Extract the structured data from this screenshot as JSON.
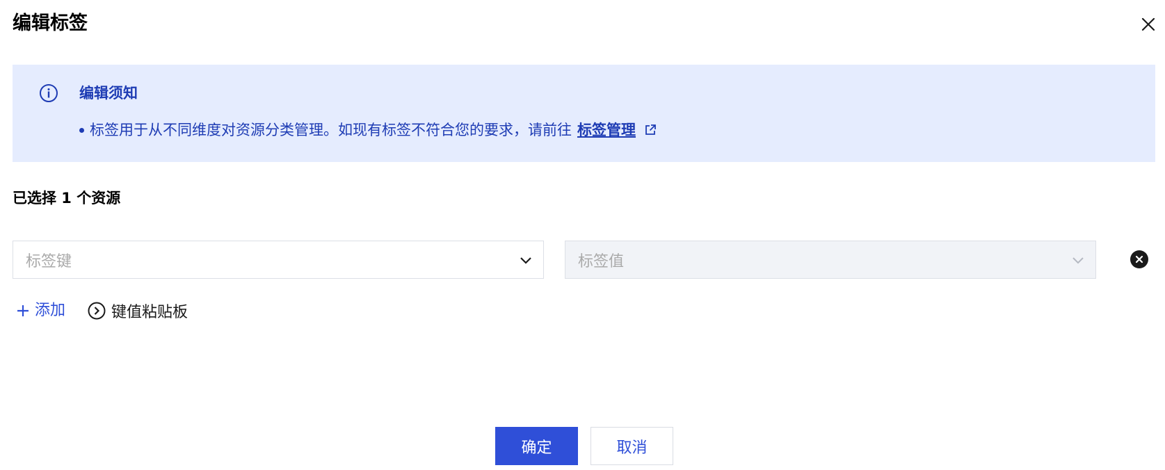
{
  "dialog": {
    "title": "编辑标签"
  },
  "notice": {
    "title": "编辑须知",
    "text": "标签用于从不同维度对资源分类管理。如现有标签不符合您的要求，请前往",
    "link_label": "标签管理"
  },
  "selection": {
    "label": "已选择 1 个资源"
  },
  "tag_row": {
    "key_placeholder": "标签键",
    "value_placeholder": "标签值"
  },
  "actions": {
    "add_label": "添加",
    "clipboard_label": "键值粘贴板"
  },
  "footer": {
    "confirm_label": "确定",
    "cancel_label": "取消"
  },
  "colors": {
    "accent": "#2f4fd8",
    "notice_bg": "#e5ecfe",
    "notice_text": "#1e3cb4",
    "disabled_bg": "#f1f3f7"
  },
  "icons": {
    "close": "close-icon",
    "info": "info-icon",
    "external_link": "external-link-icon",
    "chevron_down": "chevron-down-icon",
    "remove": "remove-circle-icon",
    "plus": "plus-icon",
    "chevron_right_circle": "chevron-right-circle-icon"
  }
}
